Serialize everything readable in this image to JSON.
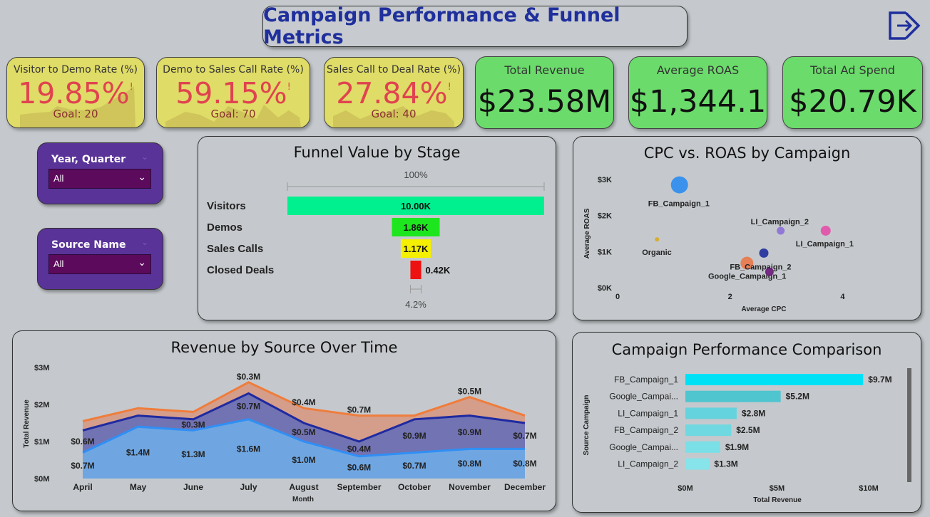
{
  "header": {
    "title": "Campaign Performance & Funnel Metrics",
    "exit_icon": "exit-arrow-icon"
  },
  "kpis": [
    {
      "label": "Visitor to Demo Rate (%)",
      "value": "19.85%",
      "alert": "!",
      "goal": "Goal: 20",
      "progress": 0.99
    },
    {
      "label": "Demo to Sales Call Rate (%)",
      "value": "59.15%",
      "alert": "!",
      "goal": "Goal: 70",
      "progress": 0.85
    },
    {
      "label": "Sales Call to Deal Rate (%)",
      "value": "27.84%",
      "alert": "!",
      "goal": "Goal: 40",
      "progress": 0.7
    },
    {
      "label": "Total Revenue",
      "value": "$23.58M"
    },
    {
      "label": "Average ROAS",
      "value": "$1,344.1"
    },
    {
      "label": "Total Ad Spend",
      "value": "$20.79K"
    }
  ],
  "colors": {
    "kpi_yellow": "#dfdc67",
    "kpi_green": "#6bdb6b",
    "alert_red": "#e0434f",
    "slicer_purple": "#5a3398",
    "title_blue": "#1f2f9c"
  },
  "slicers": [
    {
      "title": "Year, Quarter",
      "value": "All"
    },
    {
      "title": "Source Name",
      "value": "All"
    }
  ],
  "chart_data": [
    {
      "type": "bar",
      "title": "Funnel Value by Stage",
      "top_label": "100%",
      "bottom_label": "4.2%",
      "categories": [
        "Visitors",
        "Demos",
        "Sales Calls",
        "Closed Deals"
      ],
      "values": [
        10.0,
        1.86,
        1.17,
        0.42
      ],
      "value_labels": [
        "10.00K",
        "1.86K",
        "1.17K",
        "0.42K"
      ],
      "colors": [
        "#00ef8f",
        "#1ee61e",
        "#f5f000",
        "#ee1111"
      ]
    },
    {
      "type": "scatter",
      "title": "CPC vs. ROAS by Campaign",
      "xlabel": "Average CPC",
      "ylabel": "Average ROAS",
      "xlim": [
        0,
        5.2
      ],
      "ylim": [
        0,
        3000
      ],
      "xticks": [
        0,
        2,
        4
      ],
      "xtick_labels": [
        "0",
        "2",
        "4"
      ],
      "yticks": [
        0,
        1000,
        2000,
        3000
      ],
      "ytick_labels": [
        "$0K",
        "$1K",
        "$2K",
        "$3K"
      ],
      "points": [
        {
          "name": "FB_Campaign_1",
          "x": 1.1,
          "y": 2850,
          "size": 12,
          "color": "#2b8cf0"
        },
        {
          "name": "LI_Campaign_2",
          "x": 2.9,
          "y": 1580,
          "size": 5.5,
          "color": "#8b6fd8"
        },
        {
          "name": "LI_Campaign_1",
          "x": 3.7,
          "y": 1580,
          "size": 7,
          "color": "#e24fa9"
        },
        {
          "name": "Organic",
          "x": 0.7,
          "y": 1340,
          "size": 3,
          "color": "#d8a920"
        },
        {
          "name": "FB_Campaign_2",
          "x": 2.3,
          "y": 680,
          "size": 9,
          "color": "#e8784a"
        },
        {
          "name": "Google_Campaign_1",
          "x": 2.6,
          "y": 960,
          "size": 6.5,
          "color": "#1f2f9c"
        },
        {
          "name": "",
          "x": 2.7,
          "y": 440,
          "size": 6,
          "color": "#6a1a7a"
        }
      ]
    },
    {
      "type": "area",
      "title": "Revenue by Source Over Time",
      "xlabel": "Month",
      "ylabel": "Total Revenue",
      "ylim": [
        0,
        3
      ],
      "yticks": [
        0,
        1,
        2,
        3
      ],
      "ytick_labels": [
        "$0M",
        "$1M",
        "$2M",
        "$3M"
      ],
      "categories": [
        "April",
        "May",
        "June",
        "July",
        "August",
        "September",
        "October",
        "November",
        "December"
      ],
      "series": [
        {
          "values": [
            0.7,
            1.4,
            1.3,
            1.6,
            1.0,
            0.6,
            0.7,
            0.8,
            0.8
          ],
          "labels": [
            "$0.7M",
            "$1.4M",
            "$1.3M",
            "$1.6M",
            "$1.0M",
            "$0.6M",
            "$0.7M",
            "$0.8M",
            "$0.8M"
          ],
          "color": "#2f8ff5",
          "fill": "#6fa9e4"
        },
        {
          "values": [
            0.6,
            0.3,
            0.3,
            0.7,
            0.5,
            0.4,
            0.9,
            0.9,
            0.7
          ],
          "labels": [
            "$0.6M",
            "",
            "$0.3M",
            "$0.7M",
            "$0.5M",
            "$0.4M",
            "$0.9M",
            "$0.9M",
            "$0.7M"
          ],
          "color": "#1f2aa0",
          "fill": "#6d71b5"
        },
        {
          "values": [
            0.25,
            0.2,
            0.2,
            0.3,
            0.4,
            0.7,
            0.1,
            0.5,
            0.2
          ],
          "labels": [
            "",
            "",
            "",
            "$0.3M",
            "$0.4M",
            "$0.7M",
            "",
            "$0.5M",
            ""
          ],
          "color": "#ef7d3c",
          "fill": "#d69c86"
        }
      ]
    },
    {
      "type": "bar",
      "title": "Campaign Performance Comparison",
      "xlabel": "Total Revenue",
      "ylabel": "Source Campaign",
      "xlim": [
        0,
        10
      ],
      "xticks": [
        0,
        5,
        10
      ],
      "xtick_labels": [
        "$0M",
        "$5M",
        "$10M"
      ],
      "categories": [
        "FB_Campaign_1",
        "Google_Campai...",
        "LI_Campaign_1",
        "FB_Campaign_2",
        "Google_Campai...",
        "LI_Campaign_2"
      ],
      "values": [
        9.7,
        5.2,
        2.8,
        2.5,
        1.9,
        1.3
      ],
      "value_labels": [
        "$9.7M",
        "$5.2M",
        "$2.8M",
        "$2.5M",
        "$1.9M",
        "$1.3M"
      ],
      "colors": [
        "#00e1f5",
        "#4fc5d0",
        "#64d3dd",
        "#6fd8e0",
        "#7adfe6",
        "#86e4ea"
      ]
    }
  ]
}
